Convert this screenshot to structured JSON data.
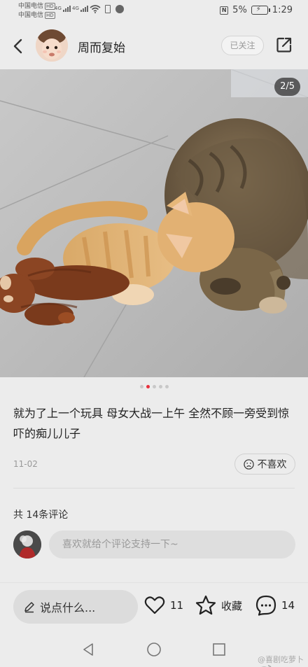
{
  "status_bar": {
    "carrier_1": "中国电信",
    "carrier_2": "中国电信",
    "hd_badge": "HD",
    "signal_1_label": "4G",
    "signal_2_label": "4G",
    "nfc": "N",
    "battery": "5%",
    "time": "1:29"
  },
  "header": {
    "title": "周而复始",
    "follow_label": "已关注"
  },
  "post": {
    "page_counter": "2/5",
    "image_count": 5,
    "current_image": 2,
    "caption": "就为了上一个玩具  母女大战一上午  全然不顾一旁受到惊吓的痴儿儿子",
    "date": "11-02",
    "dislike_label": "不喜欢"
  },
  "comments": {
    "count_label": "共 14条评论",
    "input_placeholder": "喜欢就给个评论支持一下~"
  },
  "bottom_bar": {
    "say_placeholder": "说点什么...",
    "like_count": "11",
    "collect_label": "收藏",
    "comment_count": "14"
  },
  "watermark": "@喜剧吃萝卜"
}
